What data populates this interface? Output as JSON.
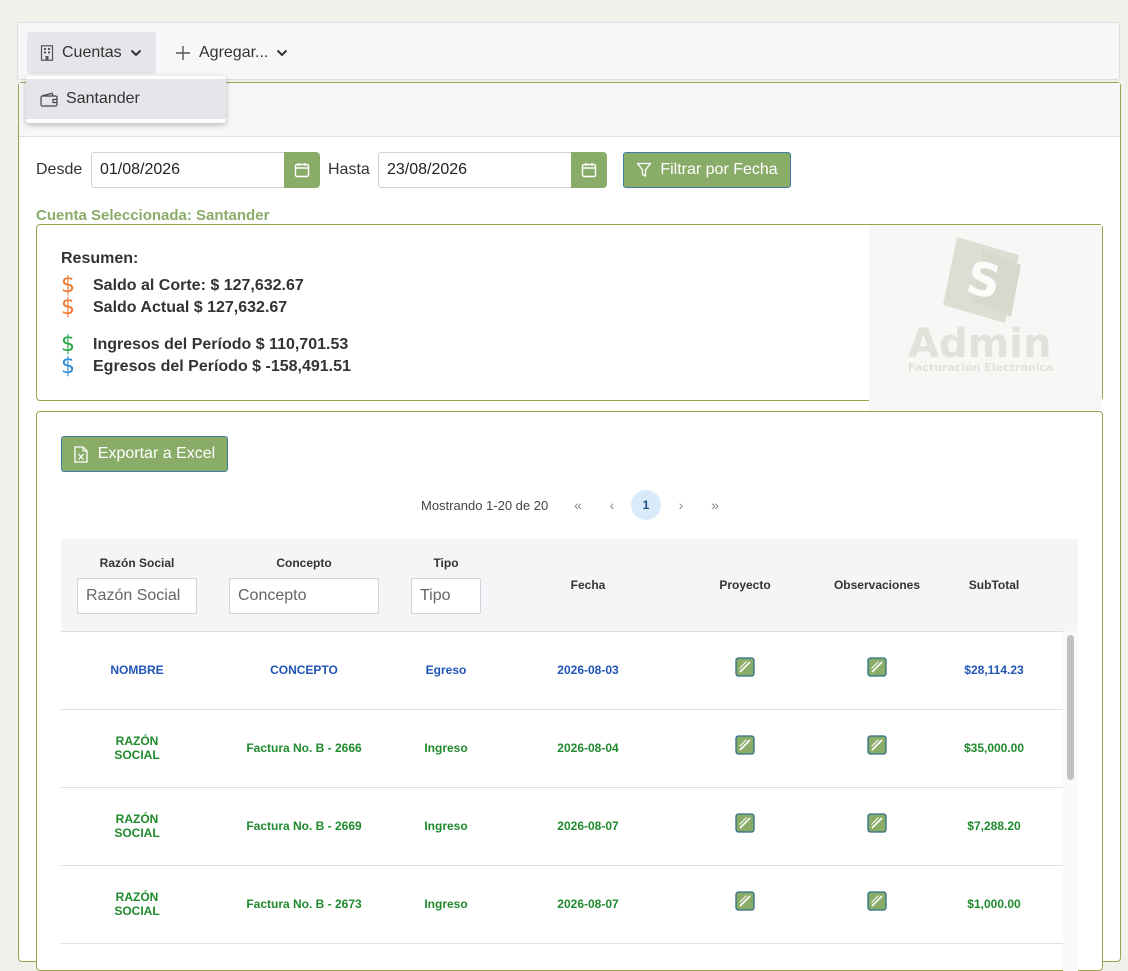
{
  "toolbar": {
    "cuentas_label": "Cuentas",
    "agregar_label": "Agregar..."
  },
  "dropdown": {
    "items": [
      {
        "label": "Santander",
        "icon": "wallet-icon"
      }
    ]
  },
  "filter": {
    "desde_label": "Desde",
    "desde_value": "01/08/2026",
    "hasta_label": "Hasta",
    "hasta_value": "23/08/2026",
    "filter_button": "Filtrar por Fecha"
  },
  "selected_account": "Cuenta Seleccionada: Santander",
  "summary": {
    "title": "Resumen:",
    "saldo_corte": "Saldo al Corte: $ 127,632.67",
    "saldo_actual": "Saldo Actual $ 127,632.67",
    "ingresos": "Ingresos del Período $ 110,701.53",
    "egresos": "Egresos del Período $ -158,491.51",
    "dollar_symbol": "$",
    "colors": {
      "orange": "#f0782d",
      "green": "#28a745",
      "blue": "#2d8ad6"
    },
    "logo_text": "Admin",
    "logo_subtext": "Facturación Electrónica"
  },
  "table": {
    "export_button": "Exportar a Excel",
    "pager_info": "Mostrando 1-20 de 20",
    "pager": {
      "first": "«",
      "prev": "‹",
      "page": "1",
      "next": "›",
      "last": "»"
    },
    "headers": {
      "razon": "Razón Social",
      "concepto": "Concepto",
      "tipo": "Tipo",
      "fecha": "Fecha",
      "proyecto": "Proyecto",
      "observaciones": "Observaciones",
      "subtotal": "SubTotal"
    },
    "placeholders": {
      "razon": "Razón Social",
      "concepto": "Concepto",
      "tipo": "Tipo"
    },
    "rows": [
      {
        "razon": "NOMBRE",
        "concepto": "CONCEPTO",
        "tipo": "Egreso",
        "fecha": "2026-08-03",
        "subtotal": "$28,114.23",
        "color": "#1f55b5"
      },
      {
        "razon": "RAZÓN SOCIAL",
        "concepto": "Factura No. B - 2666",
        "tipo": "Ingreso",
        "fecha": "2026-08-04",
        "subtotal": "$35,000.00",
        "color": "#1f8a2c"
      },
      {
        "razon": "RAZÓN SOCIAL",
        "concepto": "Factura No. B - 2669",
        "tipo": "Ingreso",
        "fecha": "2026-08-07",
        "subtotal": "$7,288.20",
        "color": "#1f8a2c"
      },
      {
        "razon": "RAZÓN SOCIAL",
        "concepto": "Factura No. B - 2673",
        "tipo": "Ingreso",
        "fecha": "2026-08-07",
        "subtotal": "$1,000.00",
        "color": "#1f8a2c"
      }
    ]
  }
}
